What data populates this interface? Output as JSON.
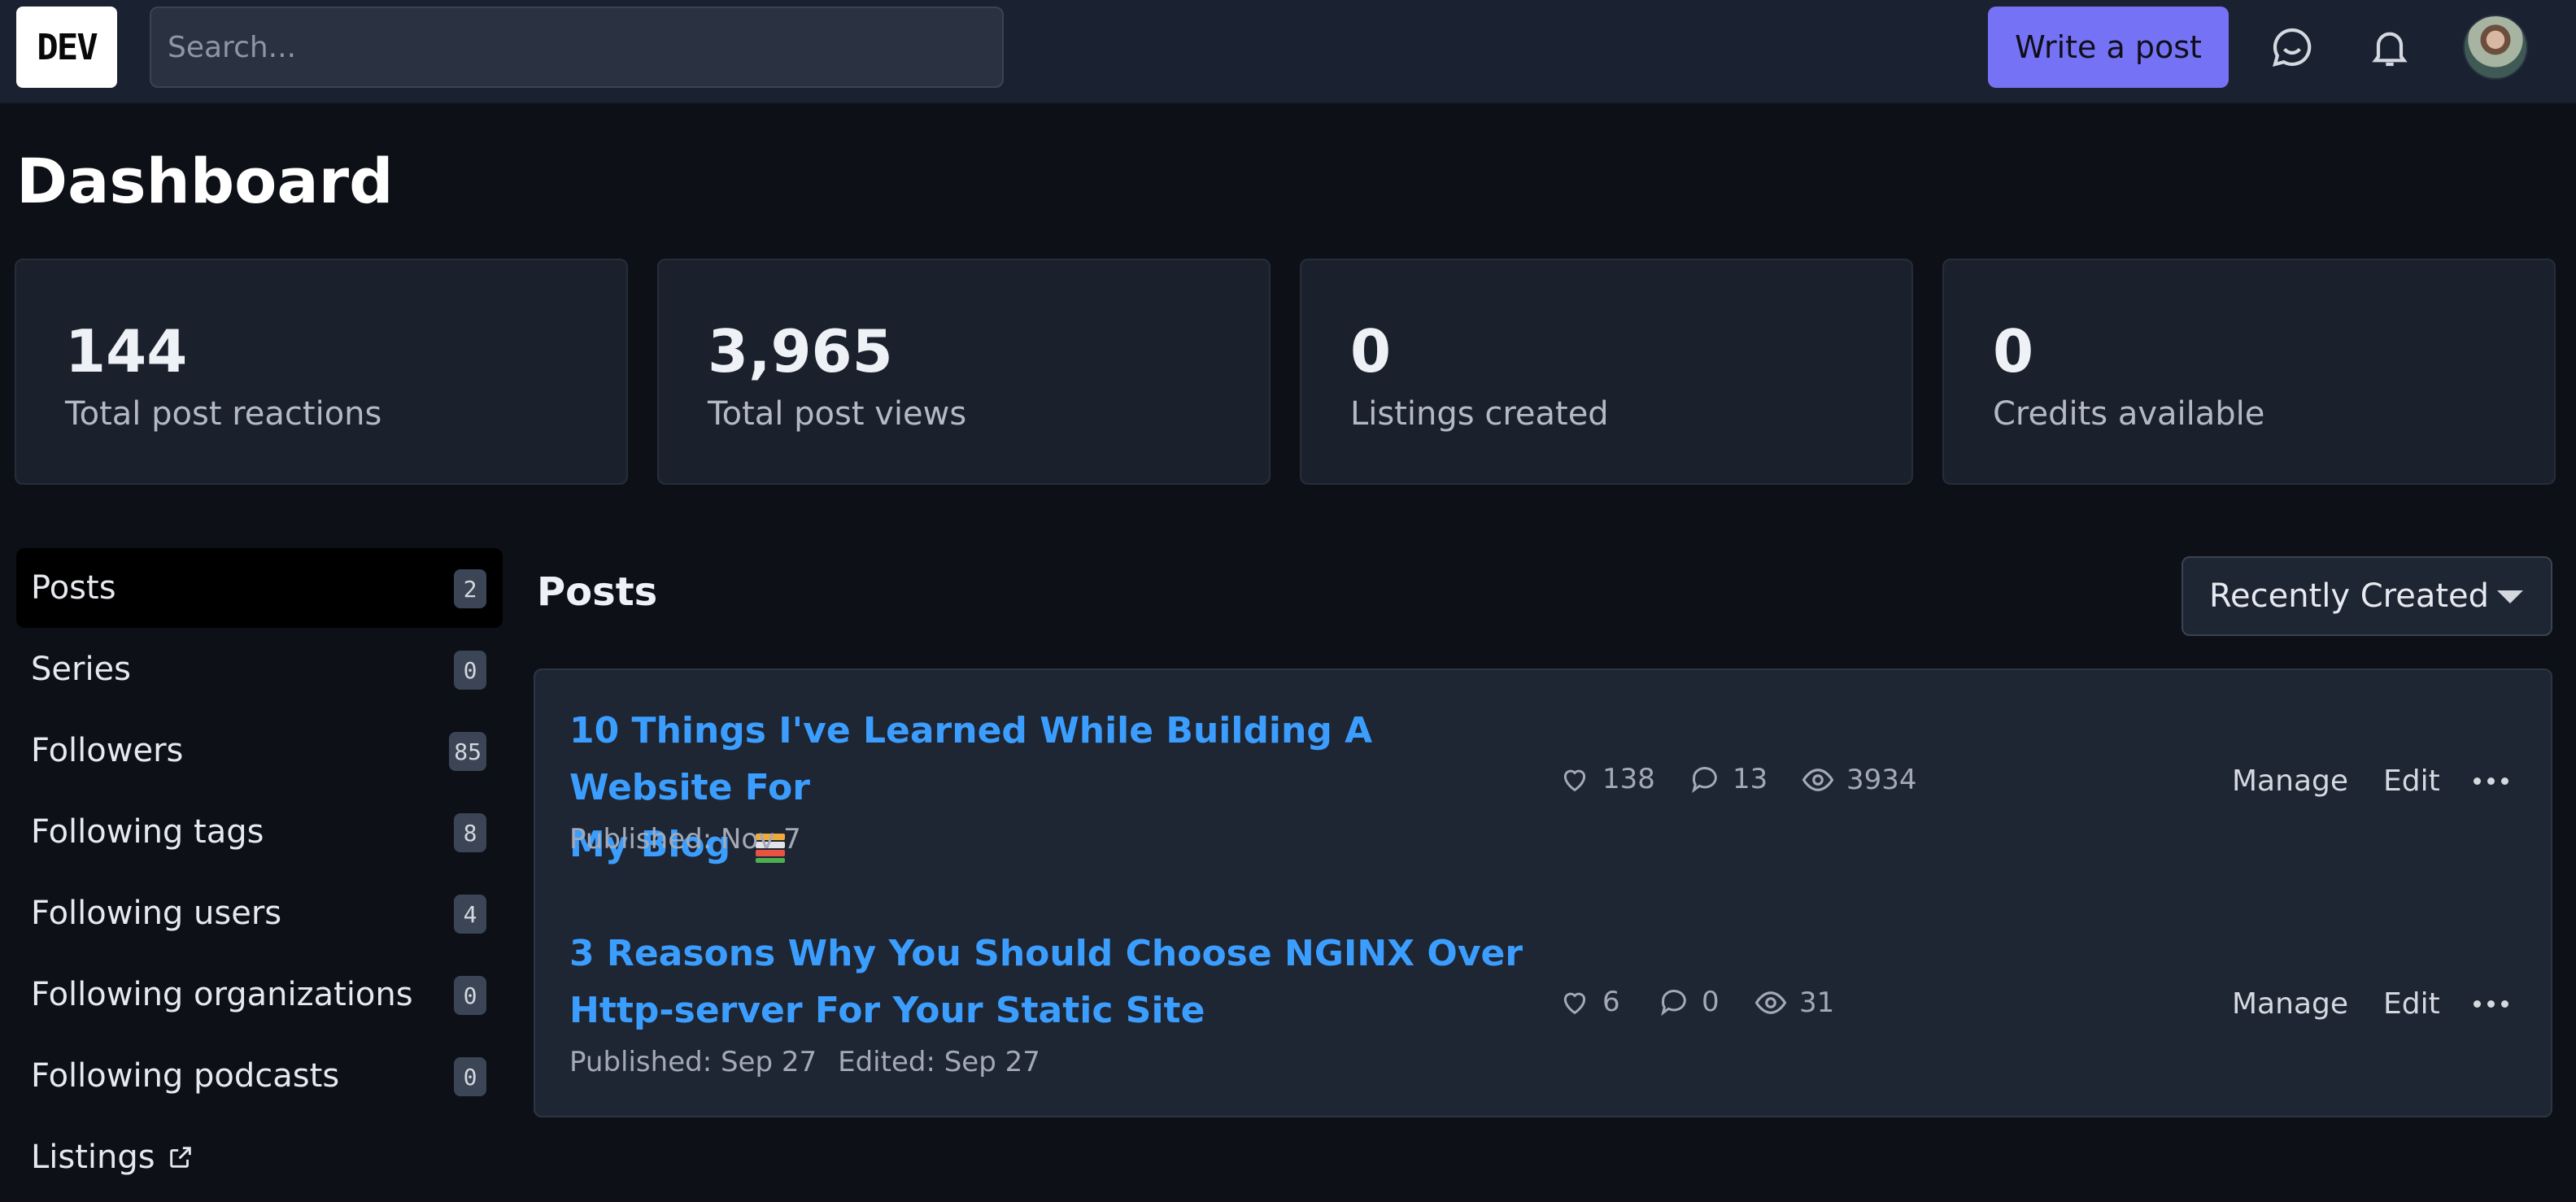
{
  "header": {
    "logo_text": "DEV",
    "search_placeholder": "Search...",
    "write_button": "Write a post",
    "icons": [
      "connect-chat-icon",
      "bell-icon"
    ],
    "accent_color": "#7672f5"
  },
  "page_title": "Dashboard",
  "stats": [
    {
      "value": "144",
      "label": "Total post reactions"
    },
    {
      "value": "3,965",
      "label": "Total post views"
    },
    {
      "value": "0",
      "label": "Listings created"
    },
    {
      "value": "0",
      "label": "Credits available"
    }
  ],
  "sidebar": {
    "items": [
      {
        "label": "Posts",
        "count": "2",
        "active": true
      },
      {
        "label": "Series",
        "count": "0"
      },
      {
        "label": "Followers",
        "count": "85"
      },
      {
        "label": "Following tags",
        "count": "8"
      },
      {
        "label": "Following users",
        "count": "4"
      },
      {
        "label": "Following organizations",
        "count": "0"
      },
      {
        "label": "Following podcasts",
        "count": "0"
      },
      {
        "label": "Listings",
        "icon": "external-link-icon"
      }
    ]
  },
  "posts_section": {
    "title": "Posts",
    "sort_selected": "Recently Created",
    "link_color": "#3b9eff"
  },
  "posts": [
    {
      "title_line1": "10 Things I've Learned While Building A Website For",
      "title_line2": "My Blog",
      "title_emoji": "books-emoji-icon",
      "published": "Published: Nov 7",
      "edited": "",
      "reactions": "138",
      "comments": "13",
      "views": "3934",
      "manage": "Manage",
      "edit": "Edit"
    },
    {
      "title_line1": "3 Reasons Why You Should Choose NGINX Over",
      "title_line2": "Http-server For Your Static Site",
      "published": "Published: Sep 27",
      "edited": "Edited: Sep 27",
      "reactions": "6",
      "comments": "0",
      "views": "31",
      "manage": "Manage",
      "edit": "Edit"
    }
  ]
}
